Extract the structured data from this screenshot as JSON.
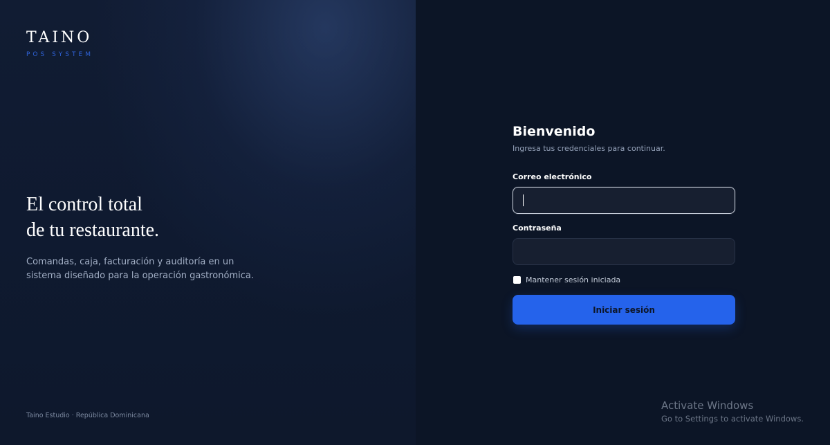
{
  "brand": {
    "name": "TAINO",
    "tagline": "POS SYSTEM"
  },
  "hero": {
    "headline_line1": "El control total",
    "headline_line2": "de tu restaurante.",
    "description": "Comandas, caja, facturación y auditoría en un sistema diseñado para la operación gastronómica."
  },
  "footer": {
    "note": "Taino Estudio · República Dominicana"
  },
  "login": {
    "title": "Bienvenido",
    "subtitle": "Ingresa tus credenciales para continuar.",
    "email_label": "Correo electrónico",
    "email_value": "",
    "password_label": "Contraseña",
    "password_value": "",
    "remember_label": "Mantener sesión iniciada",
    "remember_checked": false,
    "submit_label": "Iniciar sesión"
  },
  "system_watermark": {
    "title": "Activate Windows",
    "subtitle": "Go to Settings to activate Windows."
  },
  "colors": {
    "accent": "#2563eb",
    "brand_tagline": "#2f63d8",
    "background": "#0c1526"
  }
}
